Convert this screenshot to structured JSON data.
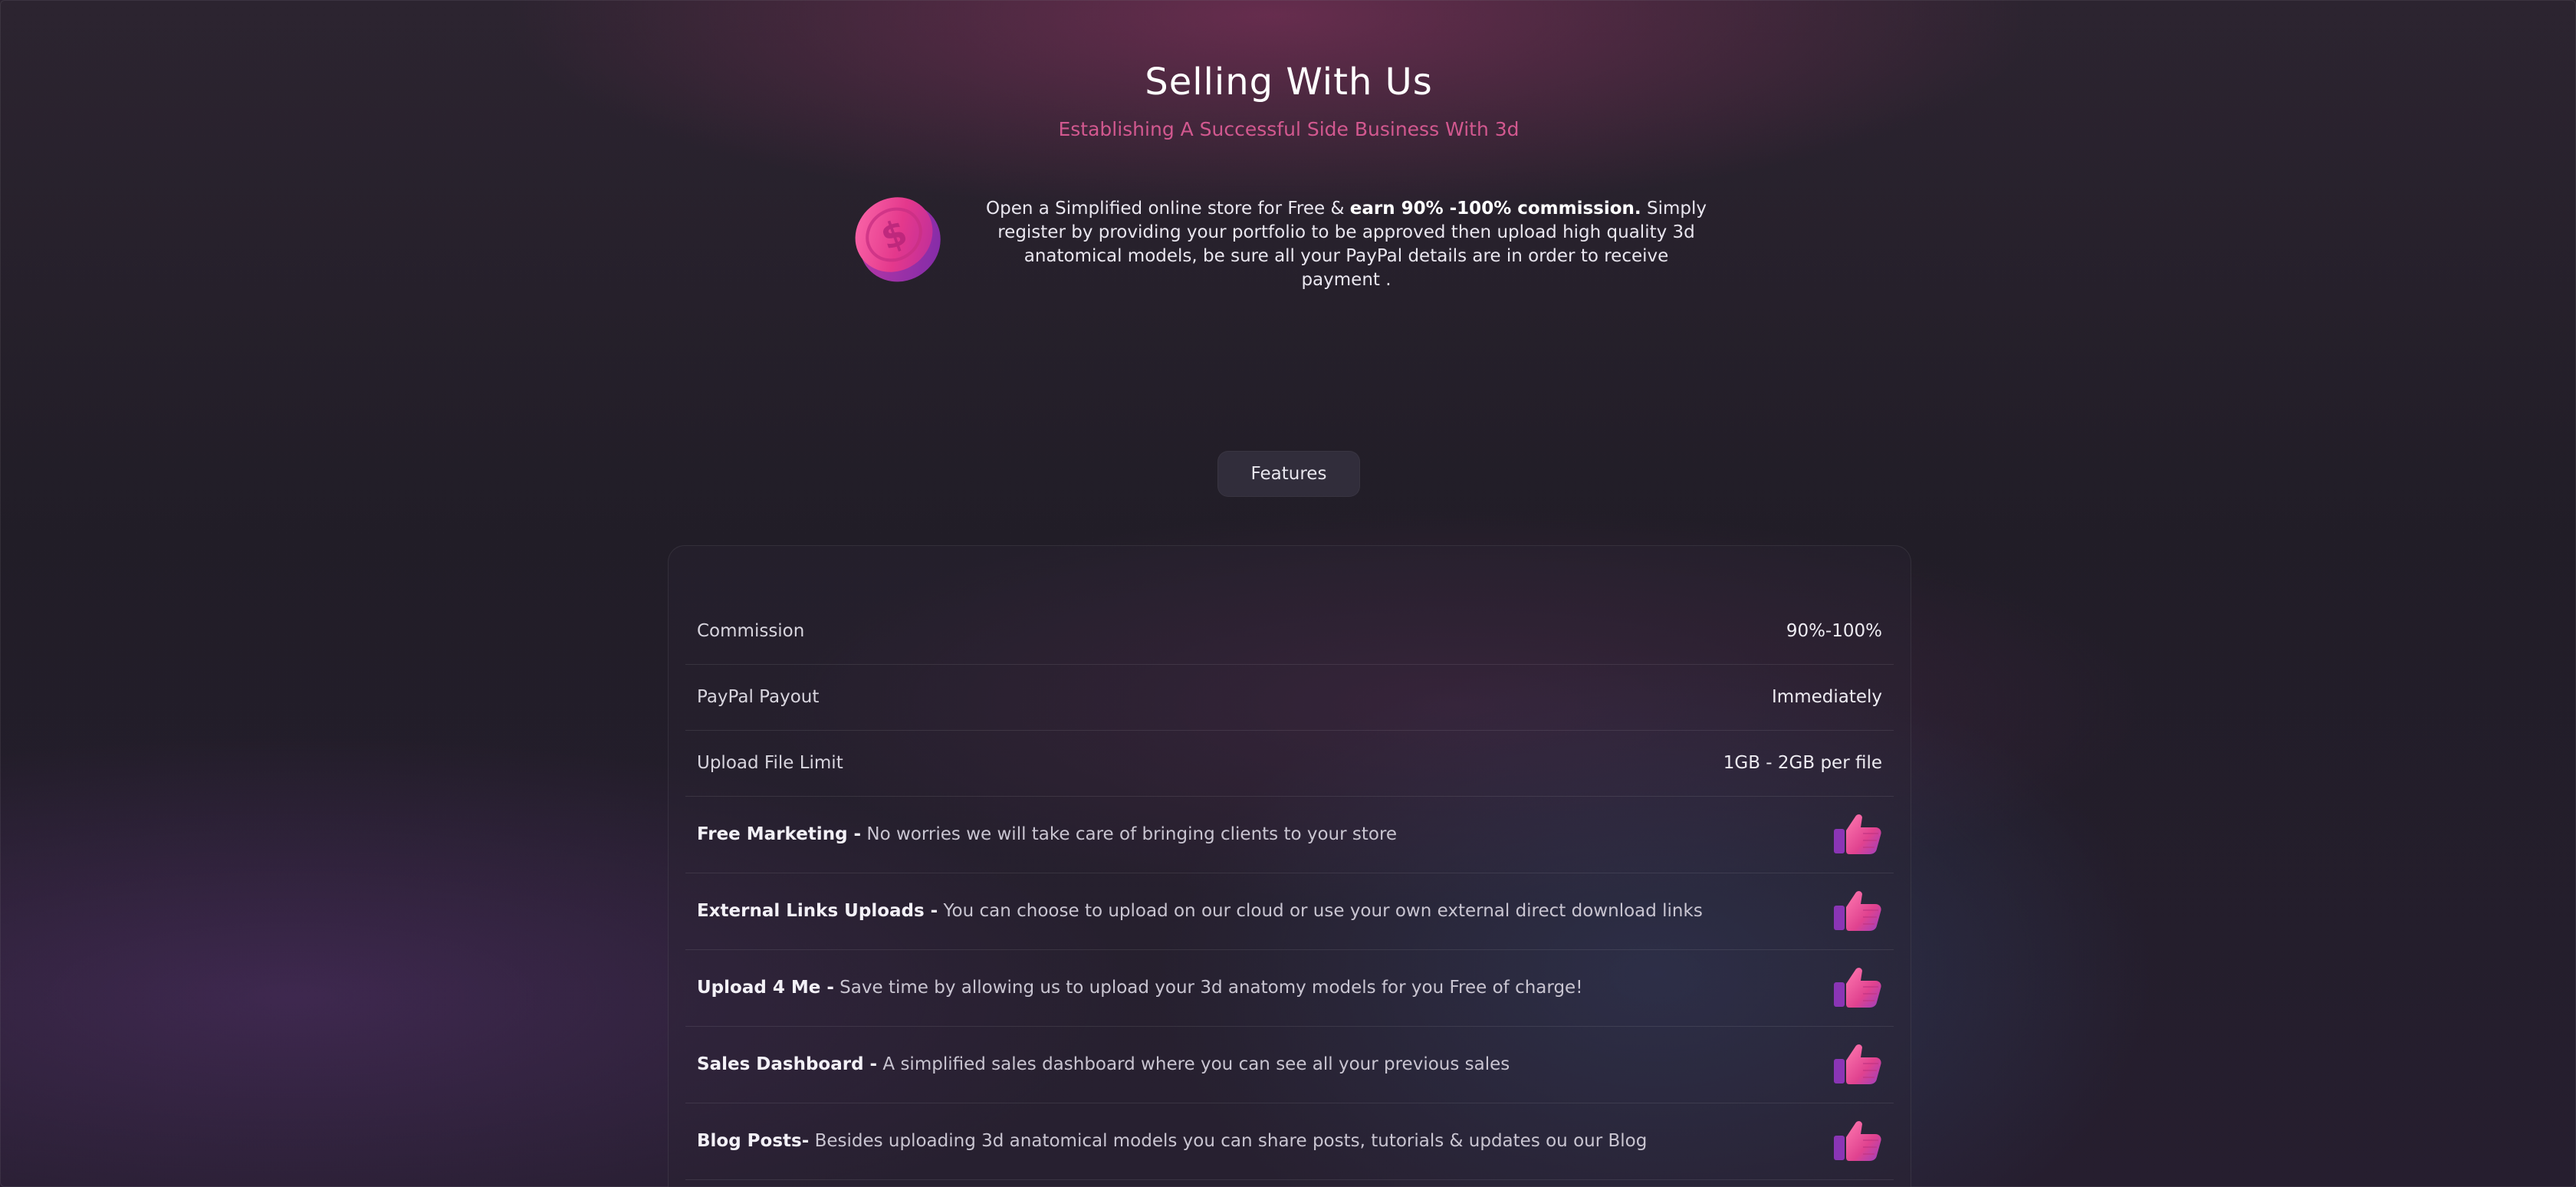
{
  "hero": {
    "title": "Selling With Us",
    "subtitle": "Establishing A Successful Side Business With 3d"
  },
  "intro": {
    "icon": "dollar-coin-icon",
    "text_before": "Open a Simplified online store for Free & ",
    "text_bold": "earn 90% -100% commission.",
    "text_after": " Simply register by providing your portfolio to be approved then upload high quality 3d anatomical models, be sure all your PayPal details are in order to receive payment ."
  },
  "features_button": {
    "label": "Features"
  },
  "features": {
    "rows": [
      {
        "label": "Commission",
        "value": "90%-100%"
      },
      {
        "label": "PayPal Payout",
        "value": "Immediately"
      },
      {
        "label": "Upload File Limit",
        "value": "1GB - 2GB per file"
      }
    ],
    "items": [
      {
        "name": "Free Marketing -",
        "description": " No worries we will take care of bringing clients to your store",
        "icon": "thumbs-up-icon"
      },
      {
        "name": "External Links Uploads -",
        "description": " You can choose to upload on our cloud or use your own external direct download links",
        "icon": "thumbs-up-icon"
      },
      {
        "name": "Upload 4 Me -",
        "description": " Save time by allowing us to upload your 3d anatomy models for you Free of charge!",
        "icon": "thumbs-up-icon"
      },
      {
        "name": "Sales Dashboard -",
        "description": " A simplified sales dashboard where you can see all your previous sales",
        "icon": "thumbs-up-icon"
      },
      {
        "name": "Blog Posts-",
        "description": " Besides uploading 3d anatomical models you can share posts, tutorials & updates ou our Blog",
        "icon": "thumbs-up-icon"
      }
    ]
  },
  "colors": {
    "accent_pink": "#d2588f",
    "icon_pink": "#e0428f",
    "icon_purple": "#9a3fc0"
  }
}
